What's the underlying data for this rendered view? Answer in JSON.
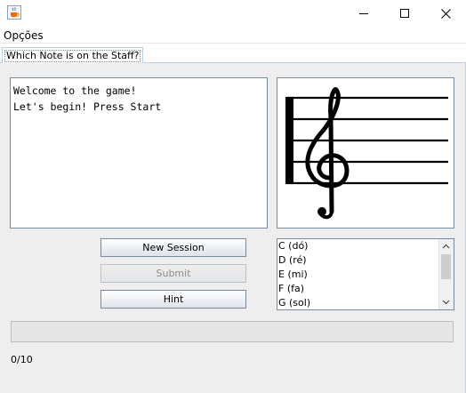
{
  "window": {
    "title": "",
    "icon": "java-coffee-cup-icon",
    "controls": [
      "minimize-icon",
      "maximize-icon",
      "close-icon"
    ]
  },
  "menu": {
    "items": [
      "Opções"
    ]
  },
  "tabs": [
    {
      "label": "Which Note is on the Staff?",
      "selected": true
    }
  ],
  "message": {
    "lines": [
      "Welcome to the game!",
      "Let's begin! Press Start"
    ]
  },
  "staff": {
    "clef": "treble-clef",
    "lines": 5
  },
  "buttons": {
    "new_session": "New Session",
    "submit": "Submit",
    "hint": "Hint"
  },
  "button_states": {
    "submit_enabled": false
  },
  "note_list": {
    "items": [
      "C (dó)",
      "D (ré)",
      "E (mi)",
      "F (fa)",
      "G (sol)"
    ]
  },
  "progress": {
    "fraction": 0
  },
  "score": "0/10",
  "colors": {
    "accent_border": "#7a8a99",
    "tab_border": "#b8cfe5",
    "progress": "#06b025"
  }
}
